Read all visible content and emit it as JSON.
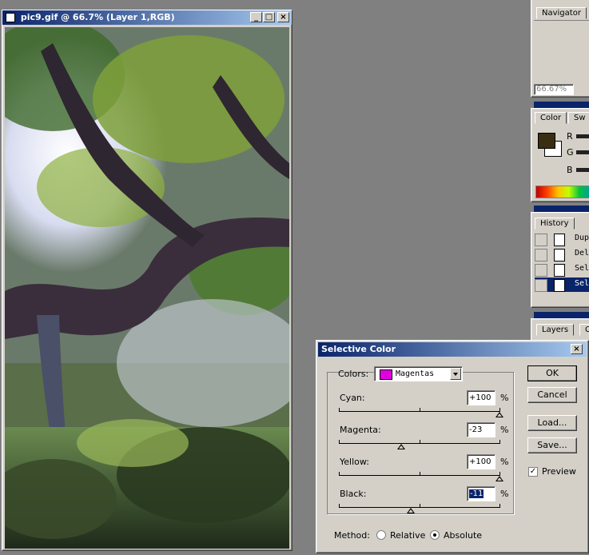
{
  "image_window": {
    "title": "pic9.gif @ 66.7% (Layer 1,RGB)",
    "buttons": [
      "_",
      "□",
      "×"
    ]
  },
  "panels": {
    "navigator": {
      "tab": "Navigator",
      "zoom": "66.67%"
    },
    "color": {
      "tabs": [
        "Color",
        "Sw"
      ],
      "channels": [
        "R",
        "G",
        "B"
      ],
      "foreground": "#3a2e12",
      "background": "#ffffff"
    },
    "history": {
      "tab": "History",
      "items": [
        "Dup",
        "Del",
        "Sel",
        "Sel"
      ]
    },
    "layers": {
      "tabs": [
        "Layers",
        "C"
      ]
    }
  },
  "dialog": {
    "title": "Selective Color",
    "colors_label": "Colors:",
    "colors_value": "Magentas",
    "colors_swatch": "#e000e0",
    "sliders": [
      {
        "label": "Cyan:",
        "value": "+100",
        "level": 100
      },
      {
        "label": "Magenta:",
        "value": "-23",
        "level": -23
      },
      {
        "label": "Yellow:",
        "value": "+100",
        "level": 100
      },
      {
        "label": "Black:",
        "value": "-11",
        "level": -11
      }
    ],
    "percent": "%",
    "buttons": {
      "ok": "OK",
      "cancel": "Cancel",
      "load": "Load...",
      "save": "Save..."
    },
    "preview_label": "Preview",
    "preview_checked": true,
    "method_label": "Method:",
    "method_options": [
      "Relative",
      "Absolute"
    ],
    "method_selected": "Absolute"
  }
}
